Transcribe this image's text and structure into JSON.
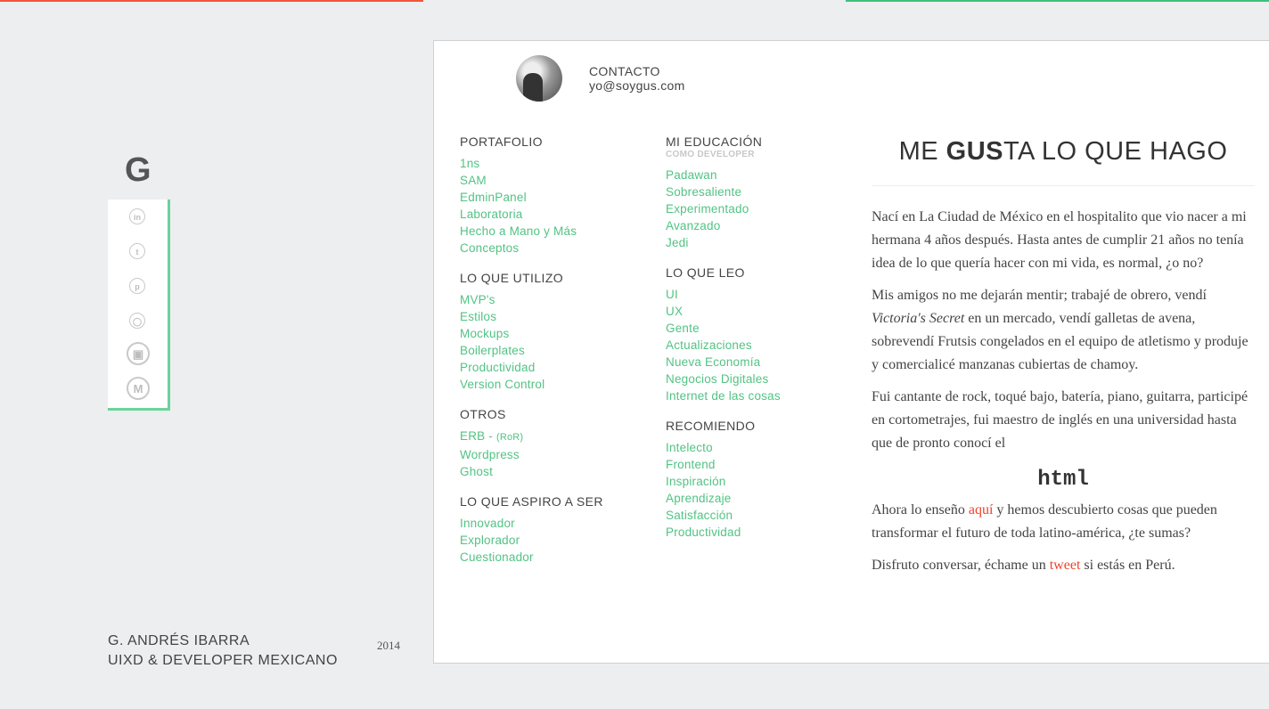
{
  "brand": {
    "logo": "G"
  },
  "social": [
    "linkedin-icon",
    "twitter-icon",
    "pinterest-icon",
    "github-icon",
    "instagram-icon",
    "medium-icon"
  ],
  "author": {
    "name": "G. ANDRÉS IBARRA",
    "role": "UIXD & DEVELOPER MEXICANO",
    "year": "2014"
  },
  "contact": {
    "label": "CONTACTO",
    "email": "yo@soygus.com"
  },
  "portfolio": {
    "title": "PORTAFOLIO",
    "items": [
      "1ns",
      "SAM",
      "EdminPanel",
      "Laboratoria",
      "Hecho a Mano y Más",
      "Conceptos"
    ]
  },
  "tools": {
    "title": "LO QUE UTILIZO",
    "items": [
      "MVP's",
      "Estilos",
      "Mockups",
      "Boilerplates",
      "Productividad",
      "Version Control"
    ]
  },
  "others": {
    "title": "OTROS",
    "items": [
      "ERB -",
      "(RoR)",
      "Wordpress",
      "Ghost"
    ]
  },
  "aspire": {
    "title": "LO QUE ASPIRO A SER",
    "items": [
      "Innovador",
      "Explorador",
      "Cuestionador"
    ]
  },
  "education": {
    "title": "MI EDUCACIÓN",
    "subtitle": "COMO DEVELOPER",
    "items": [
      "Padawan",
      "Sobresaliente",
      "Experimentado",
      "Avanzado",
      "Jedi"
    ]
  },
  "reading": {
    "title": "LO QUE LEO",
    "items": [
      "UI",
      "UX",
      "Gente",
      "Actualizaciones",
      "Nueva Economía",
      "Negocios Digitales",
      "Internet de las cosas"
    ]
  },
  "recommend": {
    "title": "RECOMIENDO",
    "items": [
      "Intelecto",
      "Frontend",
      "Inspiración",
      "Aprendizaje",
      "Satisfacción",
      "Productividad"
    ]
  },
  "article": {
    "headline_pre": "ME ",
    "headline_bold": "GUS",
    "headline_post": "TA LO QUE HAGO",
    "p1": "Nací en La Ciudad de México en el hospitalito que vio nacer a mi hermana 4 años después. Hasta antes de cumplir 21 años no tenía idea de lo que quería hacer con mi vida, es normal, ¿o no?",
    "p2_a": "Mis amigos no me dejarán mentir; trabajé de obrero, vendí ",
    "p2_em": "Victoria's Secret",
    "p2_b": " en un mercado, vendí galletas de avena, sobrevendí Frutsis congelados en el equipo de atletismo y produje y comercialicé manzanas cubiertas de chamoy.",
    "p3": "Fui cantante de rock, toqué bajo, batería, piano, guitarra, participé en cortometrajes, fui maestro de inglés en una universidad hasta que de pronto conocí el",
    "code": "html",
    "p4_a": "Ahora lo enseño ",
    "p4_link": "aquí",
    "p4_b": " y hemos descubierto cosas que pueden transformar el futuro de toda latino-américa, ¿te sumas?",
    "p5_a": "Disfruto conversar, échame un ",
    "p5_link": "tweet",
    "p5_b": " si estás en Perú."
  },
  "colors": {
    "accent_green": "#52c384",
    "accent_red": "#f0412a"
  }
}
